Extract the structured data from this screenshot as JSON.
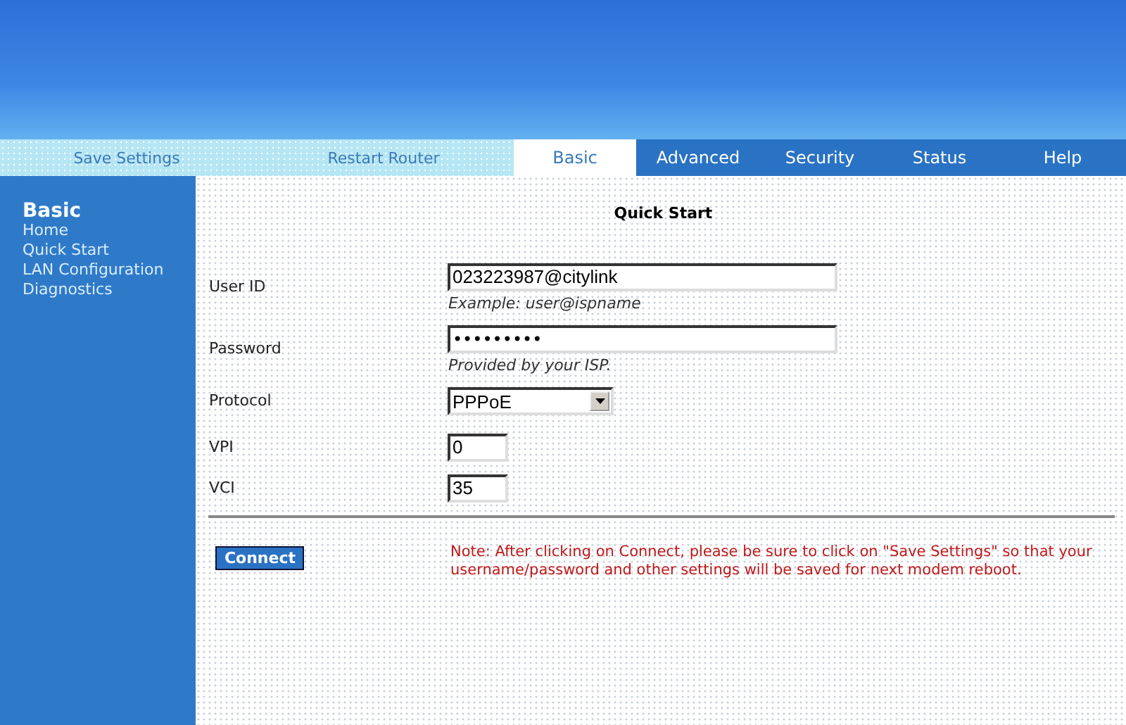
{
  "tabs": [
    {
      "label": "Save Settings",
      "kind": "action"
    },
    {
      "label": "Restart Router",
      "kind": "action"
    },
    {
      "label": "Basic",
      "kind": "tab",
      "selected": true
    },
    {
      "label": "Advanced",
      "kind": "tab",
      "selected": false
    },
    {
      "label": "Security",
      "kind": "tab",
      "selected": false
    },
    {
      "label": "Status",
      "kind": "tab",
      "selected": false
    },
    {
      "label": "Help",
      "kind": "tab",
      "selected": false
    }
  ],
  "sidebar": {
    "title": "Basic",
    "items": [
      "Home",
      "Quick Start",
      "LAN Configuration",
      "Diagnostics"
    ]
  },
  "page_title": "Quick Start",
  "fields": [
    {
      "label": "User ID",
      "kind": "text",
      "value": "023223987@citylink",
      "hint": "Example: user@ispname"
    },
    {
      "label": "Password",
      "kind": "password",
      "value": "•••••••••",
      "hint": "Provided by your ISP."
    },
    {
      "label": "Protocol",
      "kind": "select",
      "value": "PPPoE"
    },
    {
      "label": "VPI",
      "kind": "short",
      "value": "0"
    },
    {
      "label": "VCI",
      "kind": "short",
      "value": "35"
    }
  ],
  "connect_button": "Connect",
  "note": "Note: After clicking on Connect, please be sure to click on \"Save Settings\" so that your username/password and other settings will be saved for next modem reboot."
}
